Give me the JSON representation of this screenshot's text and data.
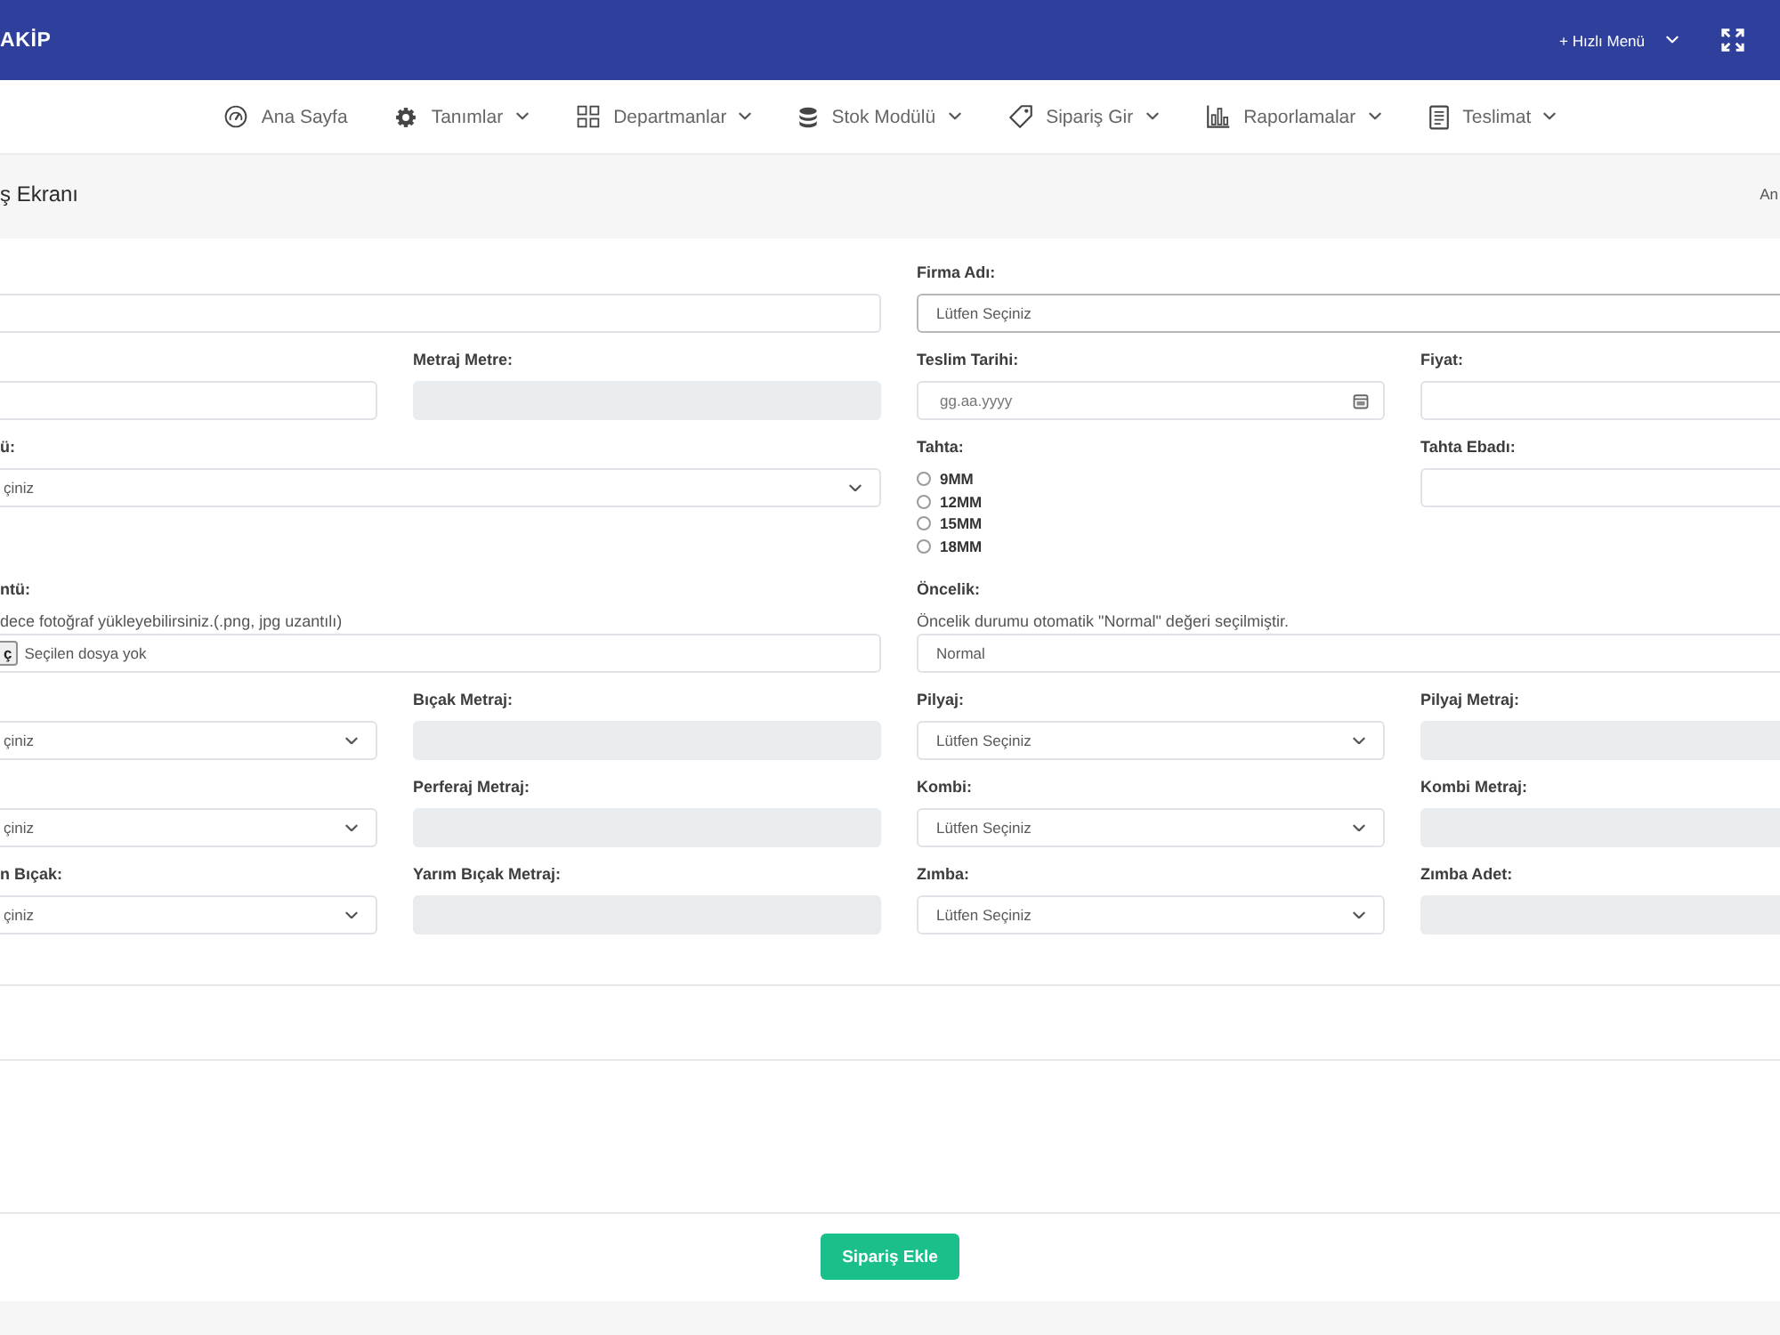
{
  "topbar": {
    "logo": "AKİP",
    "quick_menu": {
      "label": "+ Hızlı Menü",
      "dropdown": true
    }
  },
  "nav": [
    {
      "label": "Ana Sayfa",
      "dropdown": false
    },
    {
      "label": "Tanımlar",
      "dropdown": true
    },
    {
      "label": "Departmanlar",
      "dropdown": true
    },
    {
      "label": "Stok Modülü",
      "dropdown": true
    },
    {
      "label": "Sipariş Gir",
      "dropdown": true
    },
    {
      "label": "Raporlamalar",
      "dropdown": true
    },
    {
      "label": "Teslimat",
      "dropdown": true
    }
  ],
  "page_header": {
    "title": "ş Ekranı",
    "breadcrumb": "An"
  },
  "form": {
    "rows": [
      {
        "left": [
          {
            "kind": "input",
            "disabled": false
          }
        ],
        "right": [
          {
            "kind": "combo",
            "label": "Firma Adı:",
            "value": "Lütfen Seçiniz",
            "disabled": false
          }
        ]
      },
      {
        "left": [
          {
            "kind": "input",
            "disabled": false
          },
          {
            "kind": "input",
            "label": "Metraj Metre:",
            "disabled": true
          }
        ],
        "right": [
          {
            "kind": "date",
            "label": "Teslim Tarihi:",
            "placeholder": "gg.aa.yyyy",
            "disabled": false
          },
          {
            "kind": "input",
            "label": "Fiyat:",
            "disabled": false
          }
        ]
      },
      {
        "left": [
          {
            "kind": "select",
            "label": "ü:",
            "value": "çiniz",
            "disabled": false
          }
        ],
        "right": [
          {
            "kind": "radios",
            "label": "Tahta:",
            "disabled": false,
            "options": [
              {
                "label": "9MM",
                "selected": false
              },
              {
                "label": "12MM",
                "selected": false
              },
              {
                "label": "15MM",
                "selected": false
              },
              {
                "label": "18MM",
                "selected": false
              }
            ]
          },
          {
            "kind": "input",
            "label": "Tahta Ebadı:",
            "disabled": false
          }
        ]
      },
      {
        "left": [
          {
            "kind": "file",
            "label": "ntü:",
            "help": "dece fotoğraf yükleyebilirsiniz.(.png, jpg uzantılı)",
            "button": "ç",
            "value": "Seçilen dosya yok",
            "disabled": false
          }
        ],
        "right": [
          {
            "kind": "input",
            "label": "Öncelik:",
            "help": "Öncelik durumu otomatik \"Normal\" değeri seçilmiştir.",
            "value": "Normal",
            "disabled": false
          }
        ]
      },
      {
        "left": [
          {
            "kind": "select",
            "value": "çiniz",
            "disabled": false
          },
          {
            "kind": "input",
            "label": "Bıçak Metraj:",
            "disabled": true
          }
        ],
        "right": [
          {
            "kind": "select",
            "label": "Pilyaj:",
            "value": "Lütfen Seçiniz",
            "disabled": false
          },
          {
            "kind": "input",
            "label": "Pilyaj Metraj:",
            "disabled": true
          }
        ]
      },
      {
        "left": [
          {
            "kind": "select",
            "value": "çiniz",
            "disabled": false
          },
          {
            "kind": "input",
            "label": "Perferaj Metraj:",
            "disabled": true
          }
        ],
        "right": [
          {
            "kind": "select",
            "label": "Kombi:",
            "value": "Lütfen Seçiniz",
            "disabled": false
          },
          {
            "kind": "input",
            "label": "Kombi Metraj:",
            "disabled": true
          }
        ]
      },
      {
        "left": [
          {
            "kind": "select",
            "label": "n Bıçak:",
            "value": "çiniz",
            "disabled": false
          },
          {
            "kind": "input",
            "label": "Yarım Bıçak Metraj:",
            "disabled": true
          }
        ],
        "right": [
          {
            "kind": "select",
            "label": "Zımba:",
            "value": "Lütfen Seçiniz",
            "disabled": false
          },
          {
            "kind": "input",
            "label": "Zımba Adet:",
            "disabled": true
          }
        ]
      }
    ]
  },
  "submit_button": "Sipariş Ekle"
}
